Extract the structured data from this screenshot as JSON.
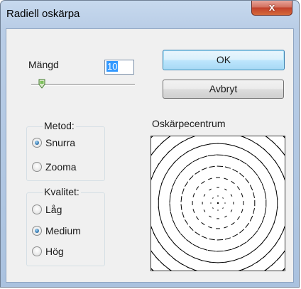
{
  "window": {
    "title": "Radiell oskärpa",
    "close_glyph": "x"
  },
  "amount": {
    "label": "Mängd",
    "value": "10",
    "slider_fraction": 0.1
  },
  "buttons": {
    "ok": "OK",
    "cancel": "Avbryt"
  },
  "method": {
    "caption": "Metod:",
    "options": [
      {
        "label": "Snurra",
        "checked": true
      },
      {
        "label": "Zooma",
        "checked": false
      }
    ]
  },
  "quality": {
    "caption": "Kvalitet:",
    "options": [
      {
        "label": "Låg",
        "checked": false
      },
      {
        "label": "Medium",
        "checked": true
      },
      {
        "label": "Hög",
        "checked": false
      }
    ]
  },
  "preview": {
    "label": "Oskärpecentrum",
    "center_icon": "blur-center-crosshair"
  },
  "colors": {
    "close_button": "#c2412c",
    "ok_border": "#3c7fb1",
    "radio_dot": "#1b5f9c",
    "title_bar": "#b9cde6"
  }
}
